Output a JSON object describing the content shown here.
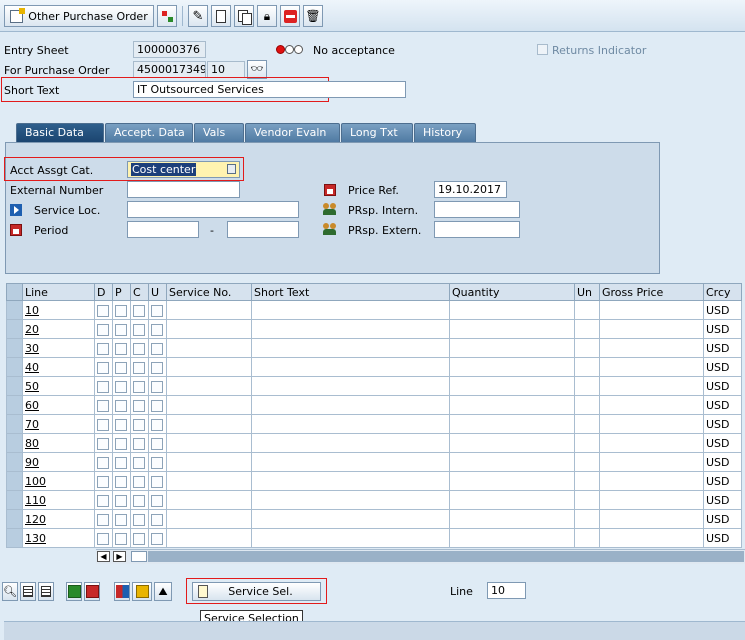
{
  "toolbar": {
    "other_po_label": "Other Purchase Order",
    "icons": [
      "document-change-icon",
      "hierarchy-icon",
      "edit-pencil-icon",
      "new-document-icon",
      "copy-icon",
      "lock-icon",
      "delete-red-icon",
      "trash-icon"
    ]
  },
  "header": {
    "entry_sheet_label": "Entry Sheet",
    "entry_sheet_value": "100000376",
    "status_text": "No acceptance",
    "returns_indicator_label": "Returns Indicator",
    "for_po_label": "For Purchase Order",
    "po_number": "4500017349",
    "po_item": "10",
    "short_text_label": "Short Text",
    "short_text_value": "IT Outsourced Services"
  },
  "tabs": [
    "Basic Data",
    "Accept. Data",
    "Vals",
    "Vendor Evaln",
    "Long Txt",
    "History"
  ],
  "basic_data": {
    "acct_assgt_label": "Acct Assgt Cat.",
    "acct_assgt_value": "Cost center",
    "external_number_label": "External Number",
    "external_number_value": "",
    "service_loc_label": "Service Loc.",
    "service_loc_value": "",
    "period_label": "Period",
    "period_from": "",
    "period_sep": "-",
    "period_to": "",
    "price_ref_label": "Price Ref.",
    "price_ref_value": "19.10.2017",
    "prsp_intern_label": "PRsp. Intern.",
    "prsp_intern_value": "",
    "prsp_extern_label": "PRsp. Extern.",
    "prsp_extern_value": ""
  },
  "table": {
    "columns": [
      "Line",
      "D",
      "P",
      "C",
      "U",
      "Service No.",
      "Short Text",
      "Quantity",
      "Un",
      "Gross Price",
      "Crcy"
    ],
    "rows": [
      {
        "line": "10",
        "crcy": "USD"
      },
      {
        "line": "20",
        "crcy": "USD"
      },
      {
        "line": "30",
        "crcy": "USD"
      },
      {
        "line": "40",
        "crcy": "USD"
      },
      {
        "line": "50",
        "crcy": "USD"
      },
      {
        "line": "60",
        "crcy": "USD"
      },
      {
        "line": "70",
        "crcy": "USD"
      },
      {
        "line": "80",
        "crcy": "USD"
      },
      {
        "line": "90",
        "crcy": "USD"
      },
      {
        "line": "100",
        "crcy": "USD"
      },
      {
        "line": "110",
        "crcy": "USD"
      },
      {
        "line": "120",
        "crcy": "USD"
      },
      {
        "line": "130",
        "crcy": "USD"
      }
    ]
  },
  "bottom": {
    "service_sel_label": "Service Sel.",
    "tooltip": "Service Selection",
    "line_label": "Line",
    "line_value": "10"
  }
}
